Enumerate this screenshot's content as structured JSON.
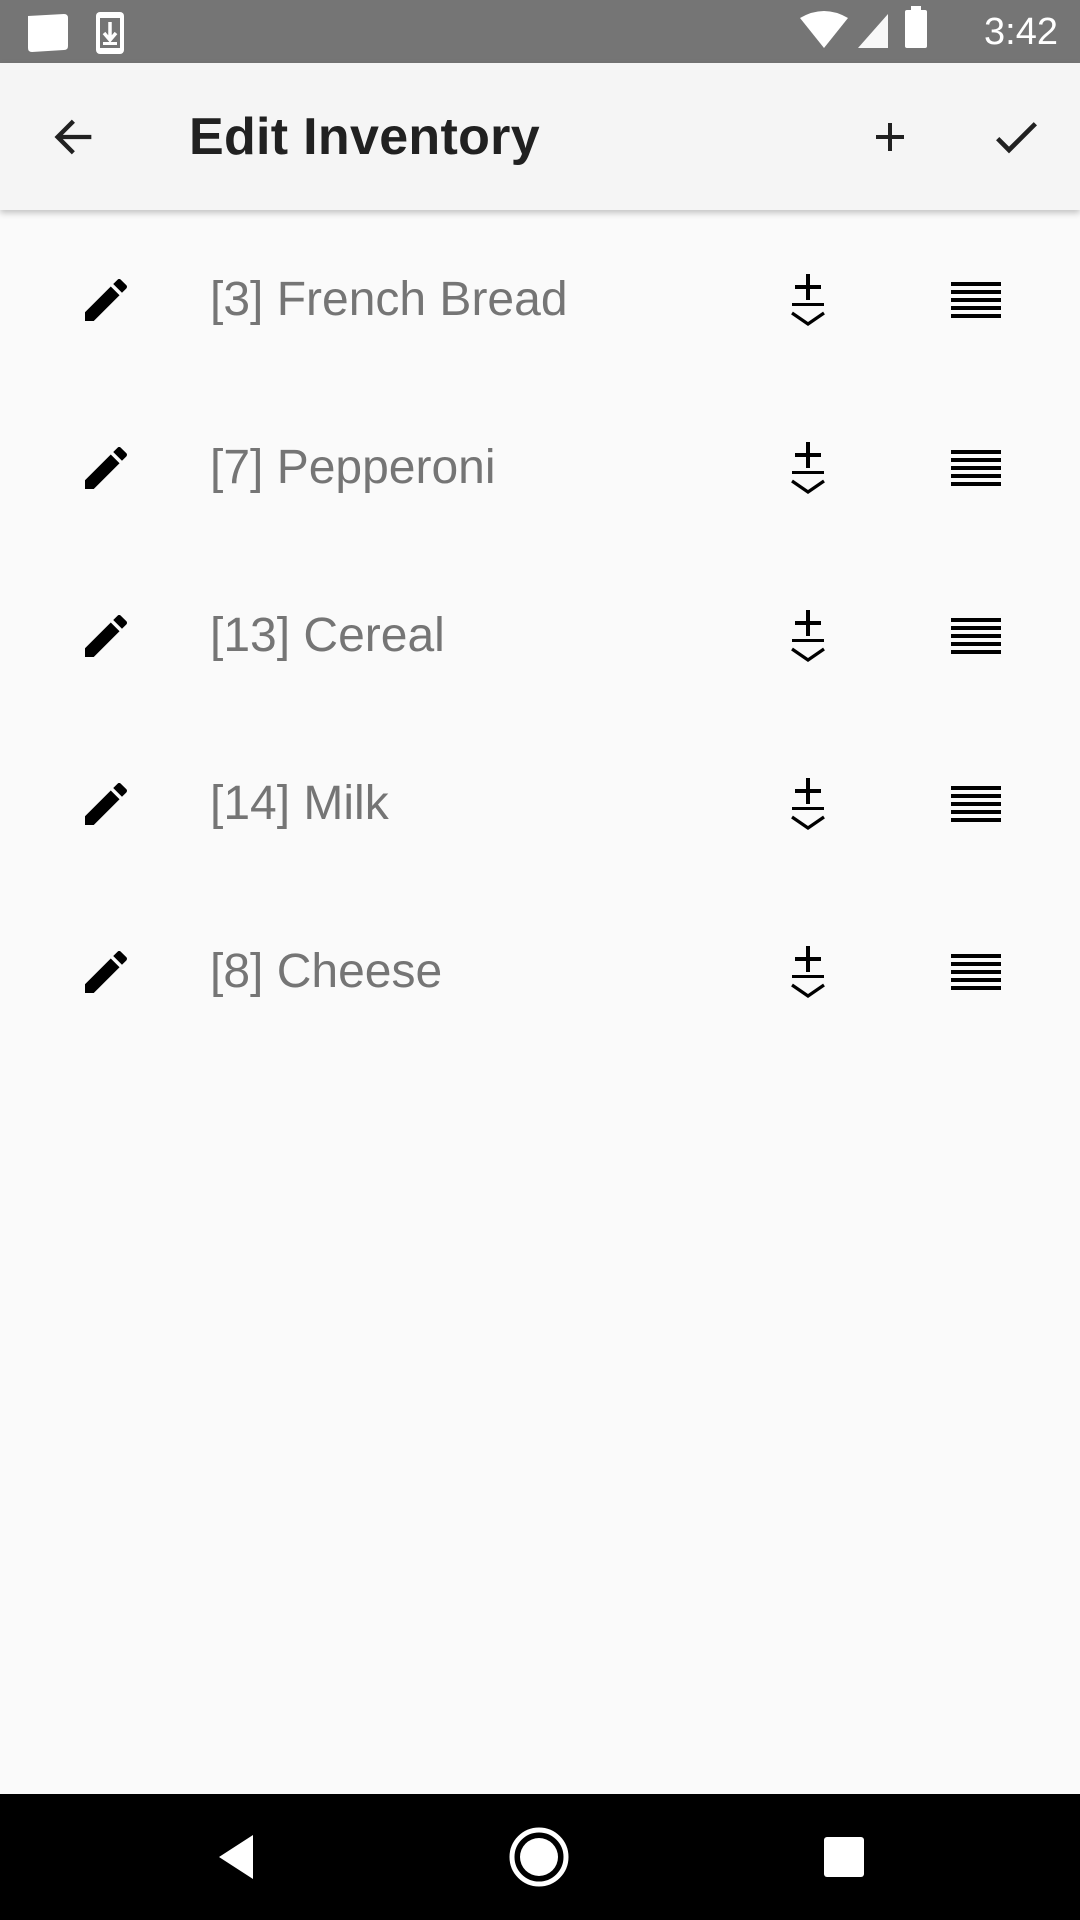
{
  "status_bar": {
    "time": "3:42",
    "icons": [
      "notification-card-icon",
      "download-icon",
      "wifi-icon",
      "signal-icon",
      "battery-icon"
    ]
  },
  "app_bar": {
    "title": "Edit Inventory",
    "back_icon": "arrow-back-icon",
    "add_icon": "add-icon",
    "done_icon": "check-icon"
  },
  "inventory": {
    "items": [
      {
        "label": "[3] French Bread"
      },
      {
        "label": "[7] Pepperoni"
      },
      {
        "label": "[13] Cereal"
      },
      {
        "label": "[14] Milk"
      },
      {
        "label": "[8] Cheese"
      }
    ],
    "row_icons": {
      "edit": "pencil-icon",
      "stock": "plus-chevron-icon",
      "drag": "drag-handle-icon"
    }
  },
  "nav_bar": {
    "icons": [
      "back-triangle-icon",
      "home-circle-icon",
      "recents-square-icon"
    ]
  },
  "colors": {
    "status_bar": "#757575",
    "app_bar": "#f5f5f5",
    "background": "#fafafa",
    "title_text": "#212121",
    "item_text": "#757575",
    "icon": "#000000",
    "nav_bar": "#000000"
  }
}
